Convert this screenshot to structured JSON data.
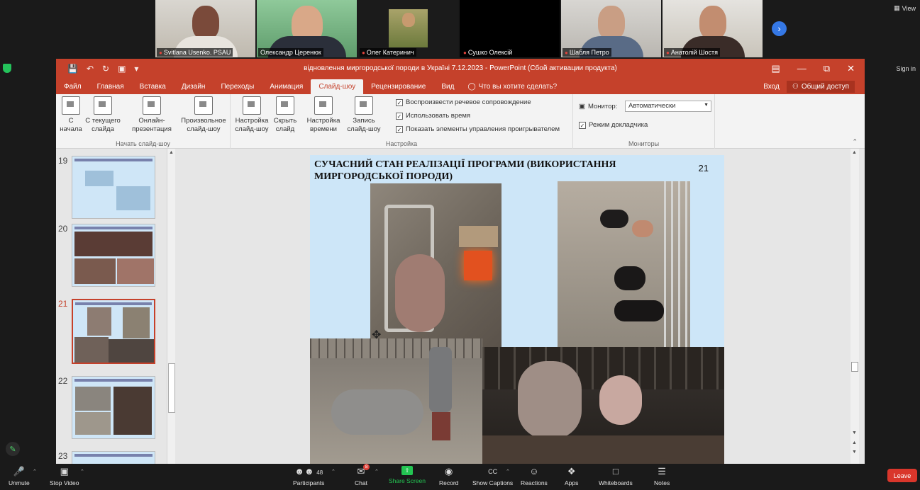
{
  "zoom": {
    "view_label": "View",
    "sign_in_label": "Sign in",
    "participants_tiles": [
      {
        "name": "Svitlana Usenko. PSAU",
        "muted": true
      },
      {
        "name": "Олександр Церенюк",
        "muted": false
      },
      {
        "name": "Олег Катеринич",
        "muted": true
      },
      {
        "name": "Сушко Олексій",
        "muted": true
      },
      {
        "name": "Шабля Петро",
        "muted": true
      },
      {
        "name": "Анатолій Шостя",
        "muted": true
      }
    ],
    "toolbar": {
      "unmute": "Unmute",
      "stop_video": "Stop Video",
      "participants": "Participants",
      "participants_count": "48",
      "chat": "Chat",
      "chat_badge": "8",
      "share_screen": "Share Screen",
      "record": "Record",
      "show_captions": "Show Captions",
      "reactions": "Reactions",
      "apps": "Apps",
      "whiteboards": "Whiteboards",
      "notes": "Notes",
      "leave": "Leave"
    }
  },
  "powerpoint": {
    "title": "відновлення миргородської породи в Україні 7.12.2023  -  PowerPoint (Сбой активации продукта)",
    "tabs": [
      "Файл",
      "Главная",
      "Вставка",
      "Дизайн",
      "Переходы",
      "Анимация",
      "Слайд-шоу",
      "Рецензирование",
      "Вид"
    ],
    "active_tab": "Слайд-шоу",
    "tell_me": "Что вы хотите сделать?",
    "login": "Вход",
    "share": "Общий доступ",
    "ribbon": {
      "group_start": "Начать слайд-шоу",
      "from_beginning": "С начала",
      "from_current": "С текущего слайда",
      "online": "Онлайн-презентация",
      "custom": "Произвольное слайд-шоу",
      "group_setup": "Настройка",
      "setup_show": "Настройка слайд-шоу",
      "hide_slide": "Скрыть слайд",
      "rehearse": "Настройка времени",
      "record": "Запись слайд-шоу",
      "chk_narration": "Воспроизвести речевое сопровождение",
      "chk_timings": "Использовать время",
      "chk_controls": "Показать элементы управления проигрывателем",
      "group_monitors": "Мониторы",
      "monitor_label": "Монитор:",
      "monitor_value": "Автоматически",
      "presenter_view": "Режим докладчика"
    },
    "thumbnails": [
      {
        "number": "19",
        "selected": false
      },
      {
        "number": "20",
        "selected": false
      },
      {
        "number": "21",
        "selected": true
      },
      {
        "number": "22",
        "selected": false
      },
      {
        "number": "23",
        "selected": false
      }
    ],
    "slide": {
      "title": "СУЧАСНИЙ СТАН РЕАЛІЗАЦІЇ ПРОГРАМИ (ВИКОРИСТАННЯ МИРГОРОДСЬКОЇ ПОРОДИ)",
      "number": "21"
    }
  }
}
